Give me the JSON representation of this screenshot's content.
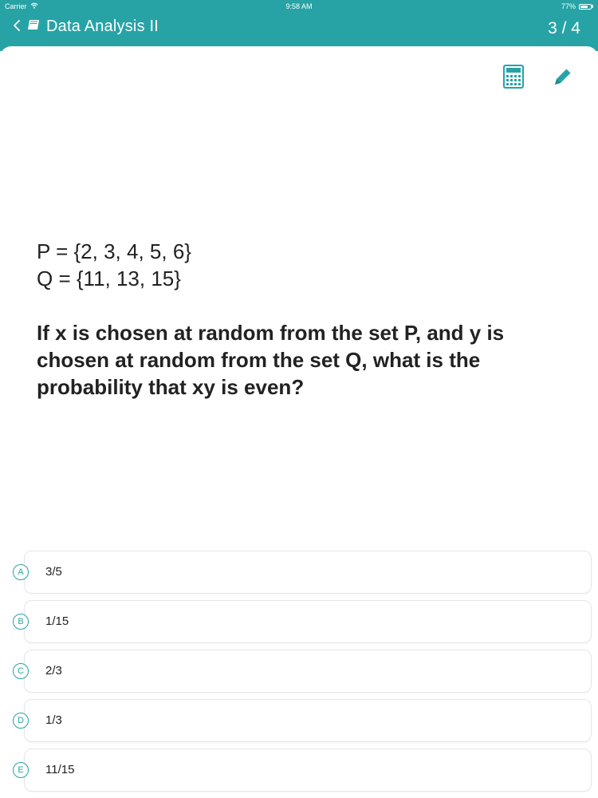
{
  "status_bar": {
    "carrier": "Carrier",
    "time": "9:58 AM",
    "battery_text": "77%",
    "battery_level": 0.77
  },
  "nav": {
    "title": "Data Analysis II",
    "progress": "3 / 4",
    "back_icon": "chevron-left-icon",
    "book_icon": "book-icon"
  },
  "tools": {
    "calculator_icon": "calculator-icon",
    "pencil_icon": "pencil-icon"
  },
  "question": {
    "set_p": "P = {2, 3, 4, 5, 6}",
    "set_q": "Q = {11, 13, 15}",
    "stem": "If x is chosen at random from the set P, and y is chosen at random from the set Q, what is the probability that xy is even?"
  },
  "choices": [
    {
      "letter": "A",
      "text": "3/5"
    },
    {
      "letter": "B",
      "text": "1/15"
    },
    {
      "letter": "C",
      "text": "2/3"
    },
    {
      "letter": "D",
      "text": "1/3"
    },
    {
      "letter": "E",
      "text": "11/15"
    }
  ],
  "colors": {
    "accent": "#27a3a6",
    "header_bg": "#27a3a6"
  }
}
